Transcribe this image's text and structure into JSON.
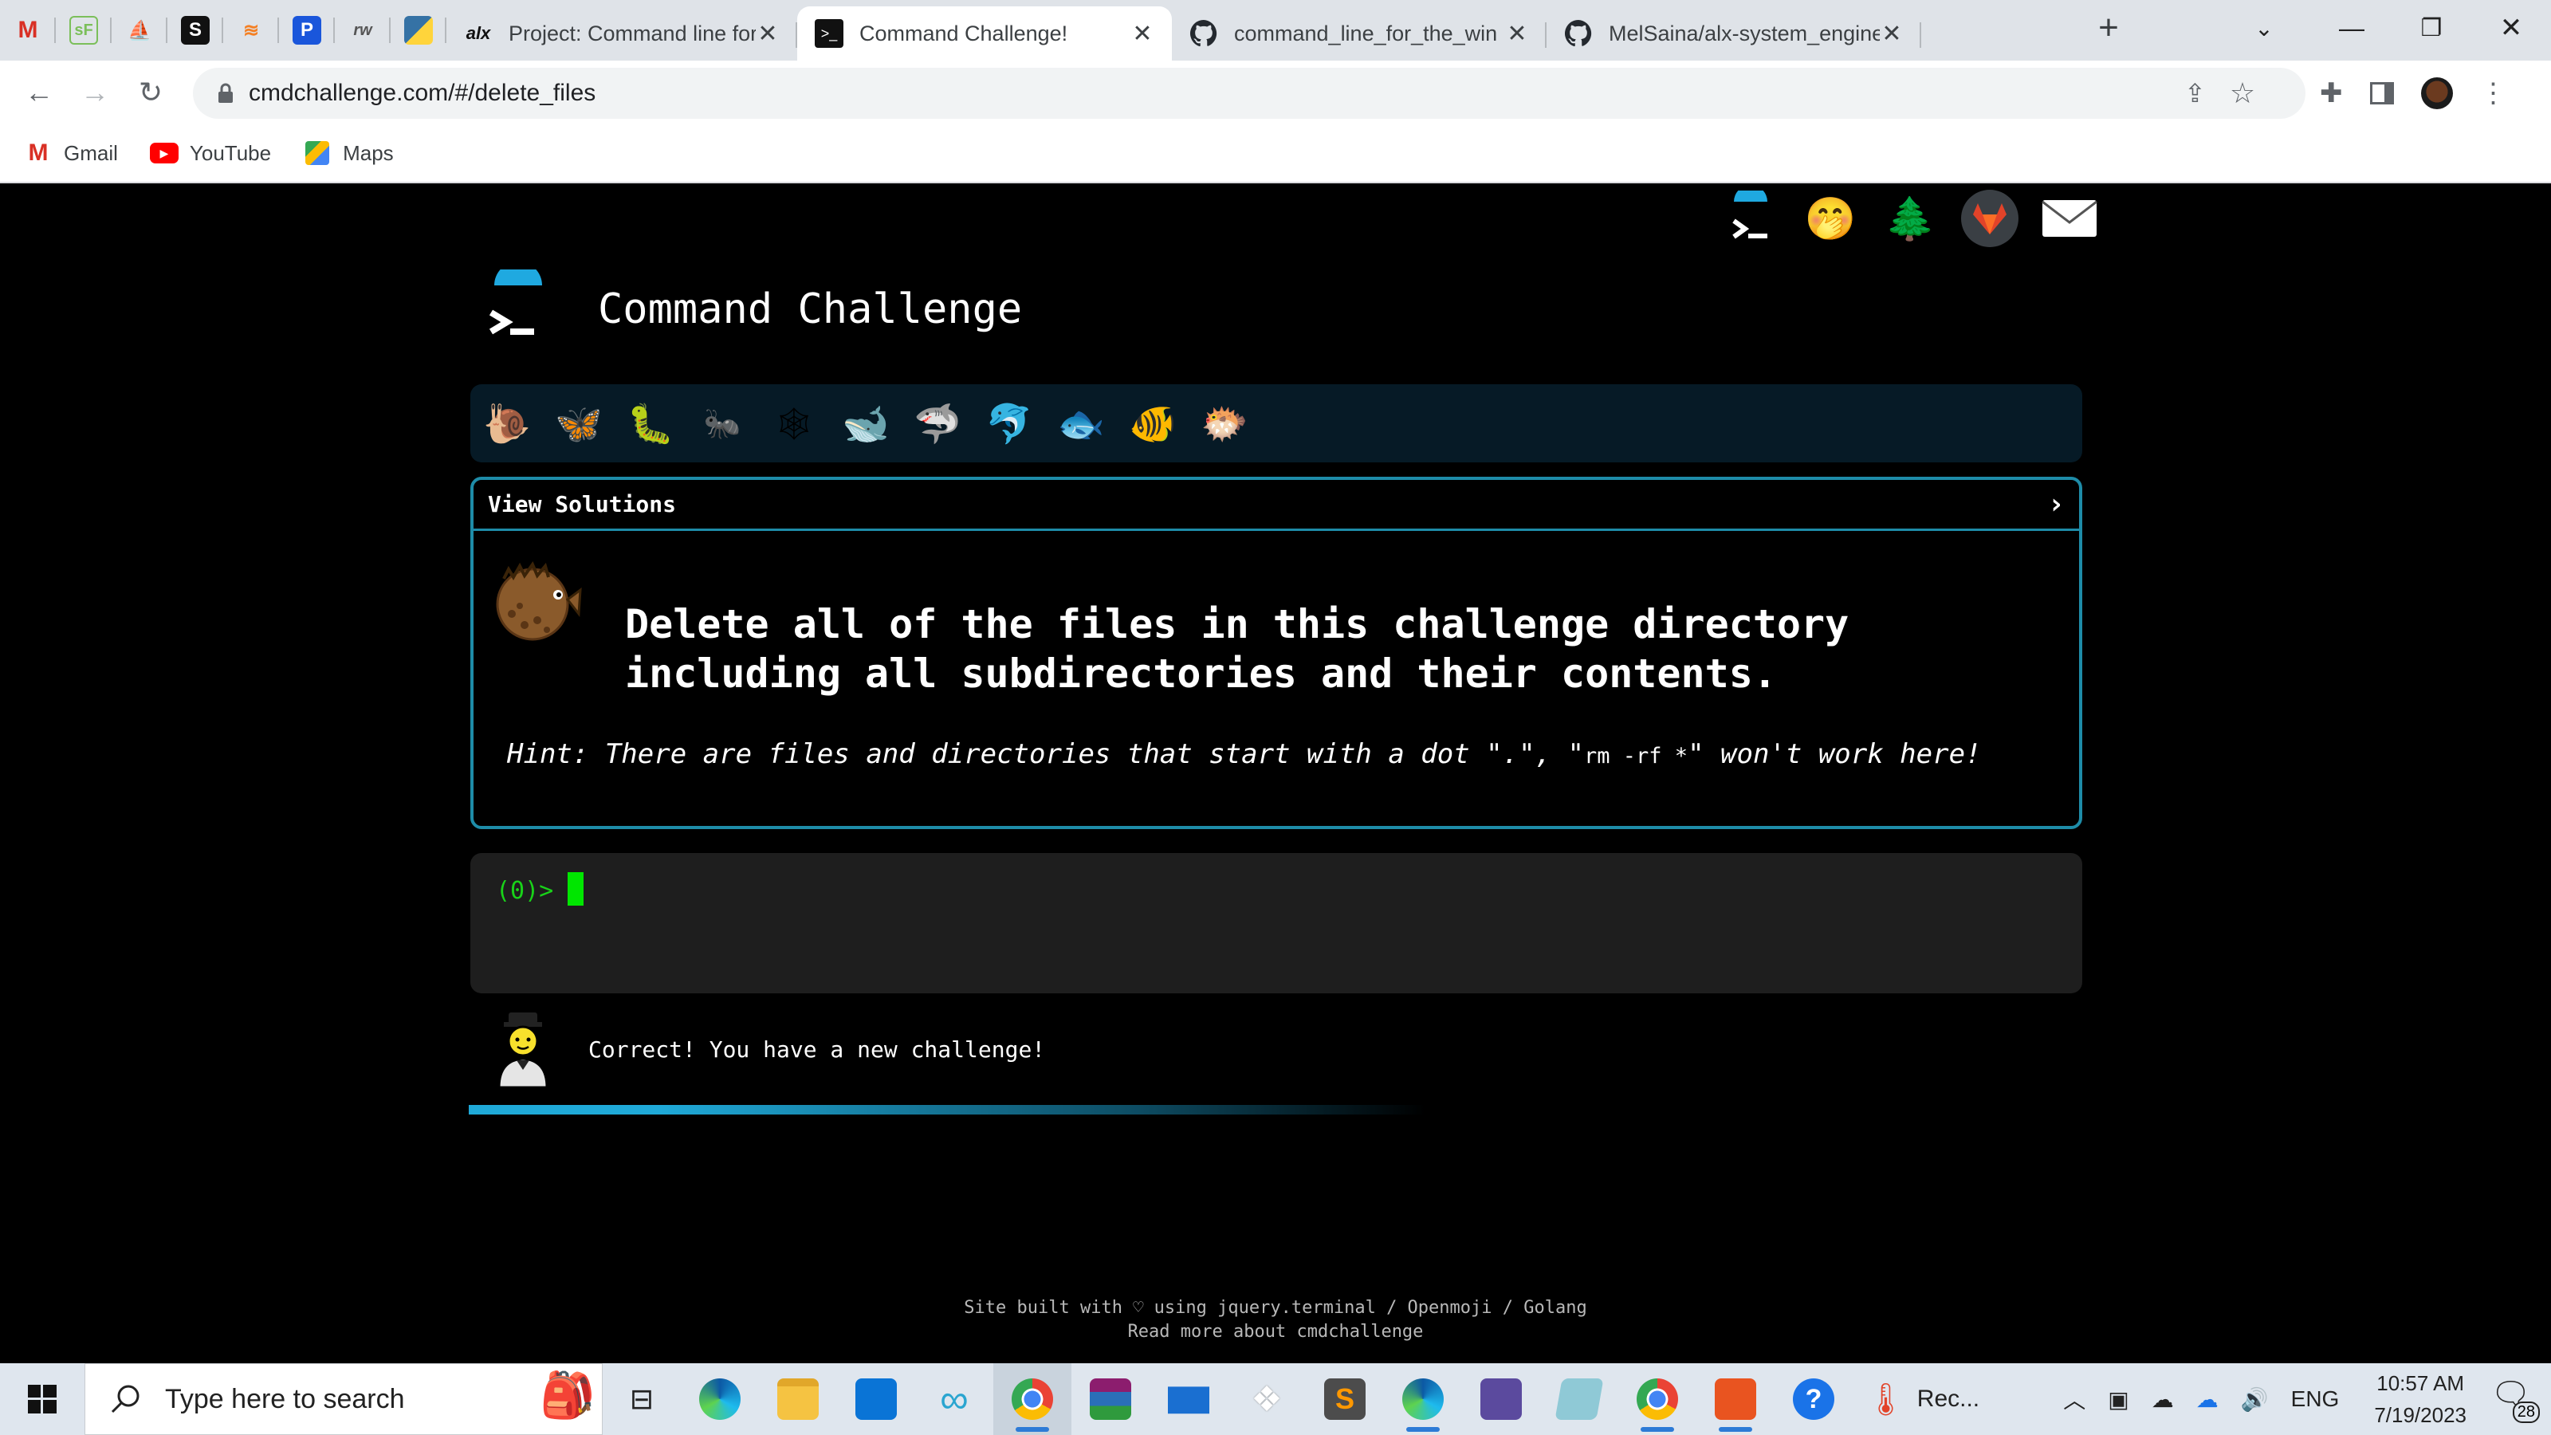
{
  "browser": {
    "tabs": [
      {
        "title": "Project: Command line for the",
        "icon": "alx-icon"
      },
      {
        "title": "Command Challenge!",
        "icon": "terminal-icon",
        "active": true
      },
      {
        "title": "command_line_for_the_win",
        "icon": "github-icon"
      },
      {
        "title": "MelSaina/alx-system_engine",
        "icon": "github-icon"
      }
    ],
    "url": "cmdchallenge.com/#/delete_files",
    "bookmarks": [
      {
        "label": "Gmail",
        "icon": "gmail-icon"
      },
      {
        "label": "YouTube",
        "icon": "youtube-icon"
      },
      {
        "label": "Maps",
        "icon": "maps-icon"
      }
    ]
  },
  "page": {
    "title": "Command Challenge",
    "card": {
      "header": "View Solutions",
      "task": "Delete all of the files in this challenge directory including all subdirectories and their contents.",
      "hint_prefix": "Hint: There are files and directories that start with a dot \".\", \"",
      "hint_code": "rm -rf *",
      "hint_suffix": "\" won't work here!"
    },
    "terminal": {
      "prompt": "(0)>"
    },
    "feedback": "Correct! You have a new challenge!",
    "footer": {
      "line1": "Site built with ♡ using jquery.terminal / Openmoji / Golang",
      "line2": "Read more about cmdchallenge"
    }
  },
  "taskbar": {
    "search_placeholder": "Type here to search",
    "recorder_label": "Rec...",
    "language": "ENG",
    "time": "10:57 AM",
    "date": "7/19/2023",
    "notification_count": "28"
  },
  "colors": {
    "accent": "#1e8ca8",
    "terminal_green": "#19d219",
    "level_bar": "#061a26"
  }
}
